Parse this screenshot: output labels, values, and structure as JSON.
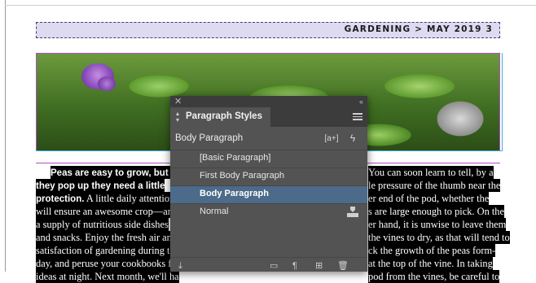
{
  "document": {
    "header": "GARDENING > MAY 2019   3",
    "body_lines": [
      {
        "text": "Peas are easy to grow, but o",
        "suffix": " You can soon learn to tell, by a",
        "bold": true
      },
      {
        "text": "they pop up they need a little",
        "suffix": "le pressure of the thumb near the",
        "bold": true
      },
      {
        "text": "protection.",
        "prefix_bold": true,
        "rest": " A little daily attention",
        "suffix": "er end of the pod, whether the"
      },
      {
        "text": "will ensure an awesome crop—and",
        "suffix": "s are large enough to pick. On the"
      },
      {
        "text": "a supply of nutritious side dishes",
        "suffix": "er hand, it is unwise to leave them"
      },
      {
        "text": "and snacks. Enjoy the fresh air and",
        "suffix": "the vines to dry, as that will tend to"
      },
      {
        "text": "satisfaction of gardening during th",
        "suffix": "ck the growth of the peas form-"
      },
      {
        "text": "day, and peruse your cookbooks fo",
        "suffix": "at the top of the vine. In taking"
      },
      {
        "text": "ideas at night. Next month, we'll ha",
        "suffix": "pod from the vines, be careful to"
      }
    ]
  },
  "panel": {
    "title": "Paragraph Styles",
    "current_style": "Body Paragraph",
    "new_override_label": "[a+]",
    "styles": [
      {
        "label": "[Basic Paragraph]",
        "selected": false
      },
      {
        "label": "First Body Paragraph",
        "selected": false
      },
      {
        "label": "Body Paragraph",
        "selected": true
      },
      {
        "label": "Normal",
        "selected": false
      }
    ]
  },
  "colors": {
    "panel_bg": "#535353",
    "panel_dark": "#3c3c3c",
    "selected_row": "#4c6a8a",
    "header_frame_bg": "#dedaf0",
    "frame_border": "#b04fc0",
    "guide": "#40b0e0"
  },
  "icons": {
    "panel_close": "close-icon",
    "panel_collapse": "collapse-icon",
    "panel_menu": "menu-icon",
    "quick_apply": "lightning-icon",
    "imported_style": "import-icon"
  }
}
